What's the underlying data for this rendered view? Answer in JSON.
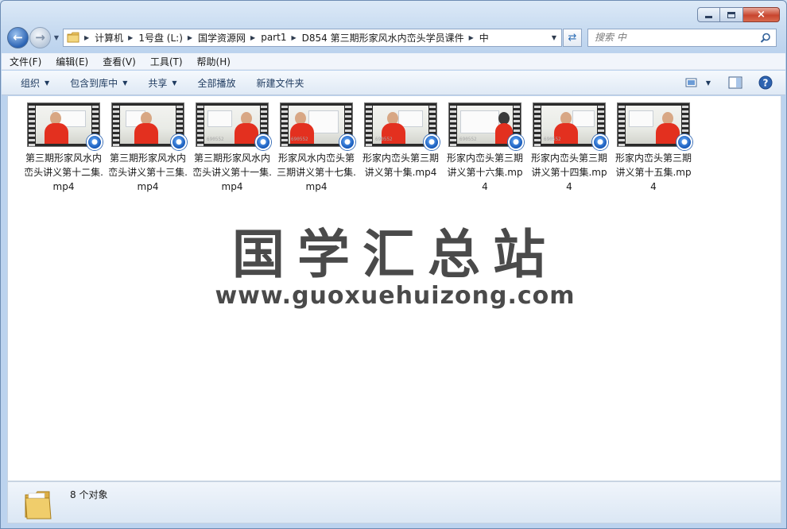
{
  "window": {
    "controls": {
      "minimize": "minimize",
      "maximize": "maximize",
      "close": "×"
    }
  },
  "nav": {
    "breadcrumbs": [
      "计算机",
      "1号盘 (L:)",
      "国学资源网",
      "part1",
      "D854 第三期形家风水内峦头学员课件",
      "中"
    ],
    "search_placeholder": "搜索 中"
  },
  "menu": [
    "文件(F)",
    "编辑(E)",
    "查看(V)",
    "工具(T)",
    "帮助(H)"
  ],
  "commands": {
    "organize": "组织",
    "include_library": "包含到库中",
    "share": "共享",
    "play_all": "全部播放",
    "new_folder": "新建文件夹"
  },
  "files": [
    {
      "name": "第三期形家风水内峦头讲义第十二集.mp4"
    },
    {
      "name": "第三期形家风水内峦头讲义第十三集.mp4"
    },
    {
      "name": "第三期形家风水内峦头讲义第十一集.mp4"
    },
    {
      "name": "形家风水内峦头第三期讲义第十七集.mp4"
    },
    {
      "name": "形家内峦头第三期讲义第十集.mp4"
    },
    {
      "name": "形家内峦头第三期讲义第十六集.mp4"
    },
    {
      "name": "形家内峦头第三期讲义第十四集.mp4"
    },
    {
      "name": "形家内峦头第三期讲义第十五集.mp4"
    }
  ],
  "watermark": {
    "title": "国学汇总站",
    "url": "www.guoxuehuizong.com"
  },
  "status": {
    "count": "8 个对象"
  },
  "colors": {
    "accent": "#2b63b3",
    "shirt": "#e3301f"
  }
}
